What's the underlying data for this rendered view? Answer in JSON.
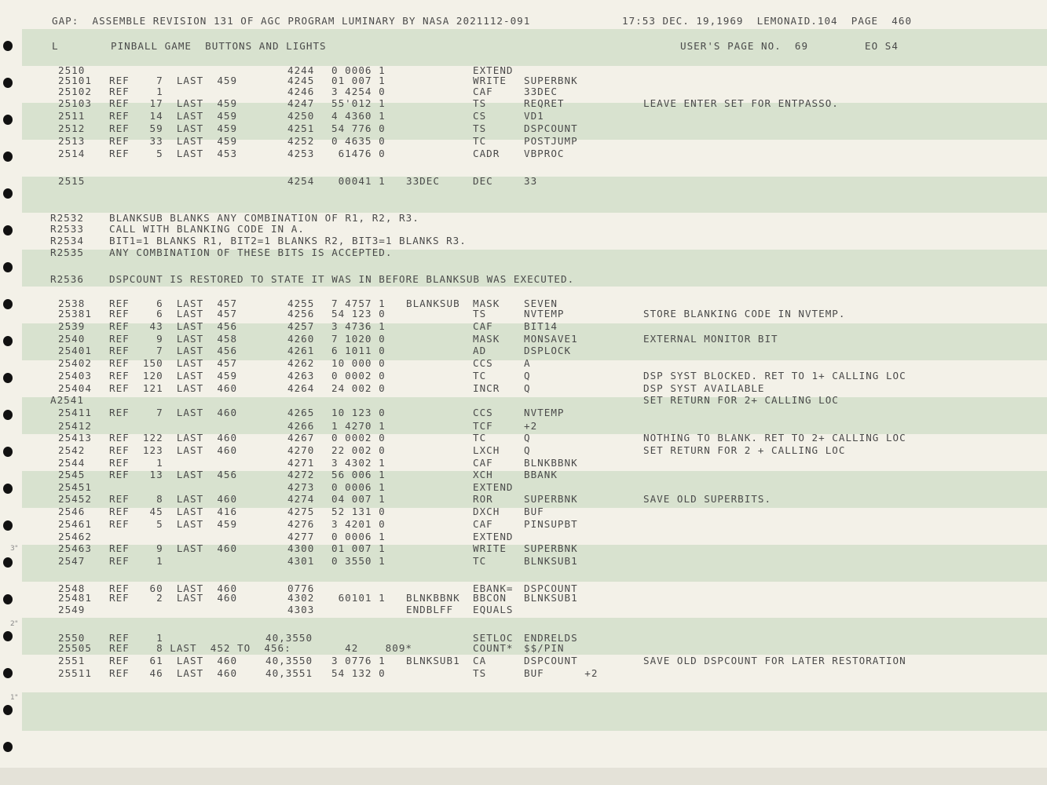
{
  "header": {
    "left": "GAP:  ASSEMBLE REVISION 131 OF AGC PROGRAM LUMINARY BY NASA 2021112-091",
    "right": "17:53 DEC. 19,1969  LEMONAID.104  PAGE  460",
    "type": "L",
    "title": "PINBALL GAME  BUTTONS AND LIGHTS",
    "user_page": "USER'S PAGE NO.  69",
    "tag": "EO S4"
  },
  "margin_marks": [
    "3\"",
    "2\"",
    "1\""
  ],
  "lines": [
    {
      "id": "2510",
      "ref": "",
      "addr": "4244",
      "data": "0 0006 1",
      "label": "",
      "op": "EXTEND",
      "operand": "",
      "comment": ""
    },
    {
      "id": "25101",
      "ref": "REF    7  LAST  459",
      "addr": "4245",
      "data": "01 007 1",
      "label": "",
      "op": "WRITE",
      "operand": "SUPERBNK",
      "comment": ""
    },
    {
      "id": "25102",
      "ref": "REF    1",
      "addr": "4246",
      "data": "3 4254 0",
      "label": "",
      "op": "CAF",
      "operand": "33DEC",
      "comment": ""
    },
    {
      "id": "25103",
      "ref": "REF   17  LAST  459",
      "addr": "4247",
      "data": "55'012 1",
      "label": "",
      "op": "TS",
      "operand": "REQRET",
      "comment": "LEAVE ENTER SET FOR ENTPASSO."
    },
    {
      "id": "2511",
      "ref": "REF   14  LAST  459",
      "addr": "4250",
      "data": "4 4360 1",
      "label": "",
      "op": "CS",
      "operand": "VD1",
      "comment": ""
    },
    {
      "id": "2512",
      "ref": "REF   59  LAST  459",
      "addr": "4251",
      "data": "54 776 0",
      "label": "",
      "op": "TS",
      "operand": "DSPCOUNT",
      "comment": ""
    },
    {
      "id": "2513",
      "ref": "REF   33  LAST  459",
      "addr": "4252",
      "data": "0 4635 0",
      "label": "",
      "op": "TC",
      "operand": "POSTJUMP",
      "comment": ""
    },
    {
      "id": "2514",
      "ref": "REF    5  LAST  453",
      "addr": "4253",
      "data": " 61476 0",
      "label": "",
      "op": "CADR",
      "operand": "VBPROC",
      "comment": ""
    },
    {
      "id": "2515",
      "ref": "",
      "addr": "4254",
      "data": " 00041 1",
      "label": "33DEC",
      "op": "DEC",
      "operand": "33",
      "comment": ""
    },
    {
      "id": "R2532",
      "ref": "BLANKSUB BLANKS ANY COMBINATION OF R1, R2, R3.",
      "addr": "",
      "data": "",
      "label": "",
      "op": "",
      "operand": "",
      "comment": ""
    },
    {
      "id": "R2533",
      "ref": "CALL WITH BLANKING CODE IN A.",
      "addr": "",
      "data": "",
      "label": "",
      "op": "",
      "operand": "",
      "comment": ""
    },
    {
      "id": "R2534",
      "ref": "BIT1=1 BLANKS R1, BIT2=1 BLANKS R2, BIT3=1 BLANKS R3.",
      "addr": "",
      "data": "",
      "label": "",
      "op": "",
      "operand": "",
      "comment": ""
    },
    {
      "id": "R2535",
      "ref": "ANY COMBINATION OF THESE BITS IS ACCEPTED.",
      "addr": "",
      "data": "",
      "label": "",
      "op": "",
      "operand": "",
      "comment": ""
    },
    {
      "id": "R2536",
      "ref": "DSPCOUNT IS RESTORED TO STATE IT WAS IN BEFORE BLANKSUB WAS EXECUTED.",
      "addr": "",
      "data": "",
      "label": "",
      "op": "",
      "operand": "",
      "comment": ""
    },
    {
      "id": "2538",
      "ref": "REF    6  LAST  457",
      "addr": "4255",
      "data": "7 4757 1",
      "label": "BLANKSUB",
      "op": "MASK",
      "operand": "SEVEN",
      "comment": ""
    },
    {
      "id": "25381",
      "ref": "REF    6  LAST  457",
      "addr": "4256",
      "data": "54 123 0",
      "label": "",
      "op": "TS",
      "operand": "NVTEMP",
      "comment": "STORE BLANKING CODE IN NVTEMP."
    },
    {
      "id": "2539",
      "ref": "REF   43  LAST  456",
      "addr": "4257",
      "data": "3 4736 1",
      "label": "",
      "op": "CAF",
      "operand": "BIT14",
      "comment": ""
    },
    {
      "id": "2540",
      "ref": "REF    9  LAST  458",
      "addr": "4260",
      "data": "7 1020 0",
      "label": "",
      "op": "MASK",
      "operand": "MONSAVE1",
      "comment": "EXTERNAL MONITOR BIT"
    },
    {
      "id": "25401",
      "ref": "REF    7  LAST  456",
      "addr": "4261",
      "data": "6 1011 0",
      "label": "",
      "op": "AD",
      "operand": "DSPLOCK",
      "comment": ""
    },
    {
      "id": "25402",
      "ref": "REF  150  LAST  457",
      "addr": "4262",
      "data": "10 000 0",
      "label": "",
      "op": "CCS",
      "operand": "A",
      "comment": ""
    },
    {
      "id": "25403",
      "ref": "REF  120  LAST  459",
      "addr": "4263",
      "data": "0 0002 0",
      "label": "",
      "op": "TC",
      "operand": "Q",
      "comment": "DSP SYST BLOCKED. RET TO 1+ CALLING LOC"
    },
    {
      "id": "25404",
      "ref": "REF  121  LAST  460",
      "addr": "4264",
      "data": "24 002 0",
      "label": "",
      "op": "INCR",
      "operand": "Q",
      "comment": "DSP SYST AVAILABLE"
    },
    {
      "id": "A2541",
      "ref": "",
      "addr": "",
      "data": "",
      "label": "",
      "op": "",
      "operand": "",
      "comment": "SET RETURN FOR 2+ CALLING LOC"
    },
    {
      "id": "25411",
      "ref": "REF    7  LAST  460",
      "addr": "4265",
      "data": "10 123 0",
      "label": "",
      "op": "CCS",
      "operand": "NVTEMP",
      "comment": ""
    },
    {
      "id": "25412",
      "ref": "",
      "addr": "4266",
      "data": "1 4270 1",
      "label": "",
      "op": "TCF",
      "operand": "+2",
      "comment": ""
    },
    {
      "id": "25413",
      "ref": "REF  122  LAST  460",
      "addr": "4267",
      "data": "0 0002 0",
      "label": "",
      "op": "TC",
      "operand": "Q",
      "comment": "NOTHING TO BLANK. RET TO 2+ CALLING LOC"
    },
    {
      "id": "2542",
      "ref": "REF  123  LAST  460",
      "addr": "4270",
      "data": "22 002 0",
      "label": "",
      "op": "LXCH",
      "operand": "Q",
      "comment": "SET RETURN FOR 2 + CALLING LOC"
    },
    {
      "id": "2544",
      "ref": "REF    1",
      "addr": "4271",
      "data": "3 4302 1",
      "label": "",
      "op": "CAF",
      "operand": "BLNKBBNK",
      "comment": ""
    },
    {
      "id": "2545",
      "ref": "REF   13  LAST  456",
      "addr": "4272",
      "data": "56 006 1",
      "label": "",
      "op": "XCH",
      "operand": "BBANK",
      "comment": ""
    },
    {
      "id": "25451",
      "ref": "",
      "addr": "4273",
      "data": "0 0006 1",
      "label": "",
      "op": "EXTEND",
      "operand": "",
      "comment": ""
    },
    {
      "id": "25452",
      "ref": "REF    8  LAST  460",
      "addr": "4274",
      "data": "04 007 1",
      "label": "",
      "op": "ROR",
      "operand": "SUPERBNK",
      "comment": "SAVE OLD SUPERBITS."
    },
    {
      "id": "2546",
      "ref": "REF   45  LAST  416",
      "addr": "4275",
      "data": "52 131 0",
      "label": "",
      "op": "DXCH",
      "operand": "BUF",
      "comment": ""
    },
    {
      "id": "25461",
      "ref": "REF    5  LAST  459",
      "addr": "4276",
      "data": "3 4201 0",
      "label": "",
      "op": "CAF",
      "operand": "PINSUPBT",
      "comment": ""
    },
    {
      "id": "25462",
      "ref": "",
      "addr": "4277",
      "data": "0 0006 1",
      "label": "",
      "op": "EXTEND",
      "operand": "",
      "comment": ""
    },
    {
      "id": "25463",
      "ref": "REF    9  LAST  460",
      "addr": "4300",
      "data": "01 007 1",
      "label": "",
      "op": "WRITE",
      "operand": "SUPERBNK",
      "comment": ""
    },
    {
      "id": "2547",
      "ref": "REF    1",
      "addr": "4301",
      "data": "0 3550 1",
      "label": "",
      "op": "TC",
      "operand": "BLNKSUB1",
      "comment": ""
    },
    {
      "id": "2548",
      "ref": "REF   60  LAST  460",
      "addr": "0776",
      "data": "",
      "label": "",
      "op": "EBANK=",
      "operand": "DSPCOUNT",
      "comment": ""
    },
    {
      "id": "25481",
      "ref": "REF    2  LAST  460",
      "addr": "4302",
      "data": " 60101 1",
      "label": "BLNKBBNK",
      "op": "BBCON",
      "operand": "BLNKSUB1",
      "comment": ""
    },
    {
      "id": "2549",
      "ref": "",
      "addr": "4303",
      "data": "",
      "label": "ENDBLFF",
      "op": "EQUALS",
      "operand": "",
      "comment": ""
    },
    {
      "id": "2550",
      "ref": "REF    1",
      "addr": "40,3550",
      "data": "",
      "label": "",
      "op": "SETLOC",
      "operand": "ENDRELDS",
      "comment": ""
    },
    {
      "id": "25505",
      "ref": "REF    8 LAST  452 TO  456:",
      "addr": "",
      "data": "  42    809*",
      "label": "",
      "op": "COUNT*",
      "operand": "$$/PIN",
      "comment": ""
    },
    {
      "id": "2551",
      "ref": "REF   61  LAST  460",
      "addr": "40,3550",
      "data": "3 0776 1",
      "label": "BLNKSUB1",
      "op": "CA",
      "operand": "DSPCOUNT",
      "comment": "SAVE OLD DSPCOUNT FOR LATER RESTORATION"
    },
    {
      "id": "25511",
      "ref": "REF   46  LAST  460",
      "addr": "40,3551",
      "data": "54 132 0",
      "label": "",
      "op": "TS",
      "operand": "BUF      +2",
      "comment": ""
    }
  ]
}
